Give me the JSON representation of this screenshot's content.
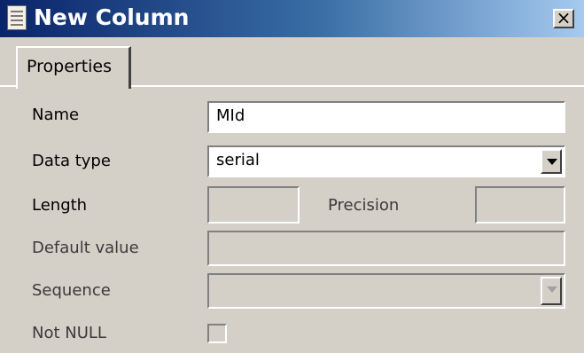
{
  "window": {
    "title": "New Column",
    "close_label": "×"
  },
  "tabs": [
    {
      "label": "Properties",
      "active": true
    }
  ],
  "form": {
    "name_label": "Name",
    "name_value": "MId",
    "data_type_label": "Data type",
    "data_type_value": "serial",
    "length_label": "Length",
    "length_value": "",
    "precision_label": "Precision",
    "precision_value": "",
    "default_label": "Default value",
    "default_value": "",
    "sequence_label": "Sequence",
    "sequence_value": "",
    "not_null_label": "Not NULL",
    "not_null_checked": false
  }
}
